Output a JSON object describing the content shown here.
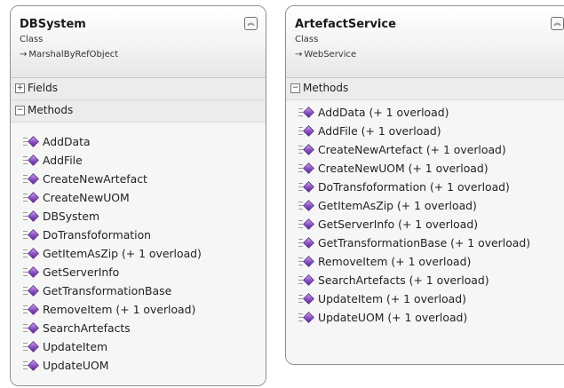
{
  "classes": [
    {
      "name": "DBSystem",
      "stereotype": "Class",
      "base": "MarshalByRefObject",
      "fields_label": "Fields",
      "methods_label": "Methods",
      "methods": [
        "AddData",
        "AddFile",
        "CreateNewArtefact",
        "CreateNewUOM",
        "DBSystem",
        "DoTransfoformation",
        "GetItemAsZip (+ 1 overload)",
        "GetServerInfo",
        "GetTransformationBase",
        "RemoveItem (+ 1 overload)",
        "SearchArtefacts",
        "UpdateItem",
        "UpdateUOM"
      ]
    },
    {
      "name": "ArtefactService",
      "stereotype": "Class",
      "base": "WebService",
      "methods_label": "Methods",
      "methods": [
        "AddData (+ 1 overload)",
        "AddFile (+ 1 overload)",
        "CreateNewArtefact (+ 1 overload)",
        "CreateNewUOM (+ 1 overload)",
        "DoTransfoformation (+ 1 overload)",
        "GetItemAsZip (+ 1 overload)",
        "GetServerInfo (+ 1 overload)",
        "GetTransformationBase (+ 1 overload)",
        "RemoveItem (+ 1 overload)",
        "SearchArtefacts (+ 1 overload)",
        "UpdateItem (+ 1 overload)",
        "UpdateUOM (+ 1 overload)"
      ]
    }
  ],
  "icons": {
    "collapse": "double-chevron-up-icon",
    "expand": "plus-box-icon",
    "collapse_section": "minus-box-icon",
    "method": "method-cube-icon",
    "inherits": "inheritance-arrow-icon"
  }
}
